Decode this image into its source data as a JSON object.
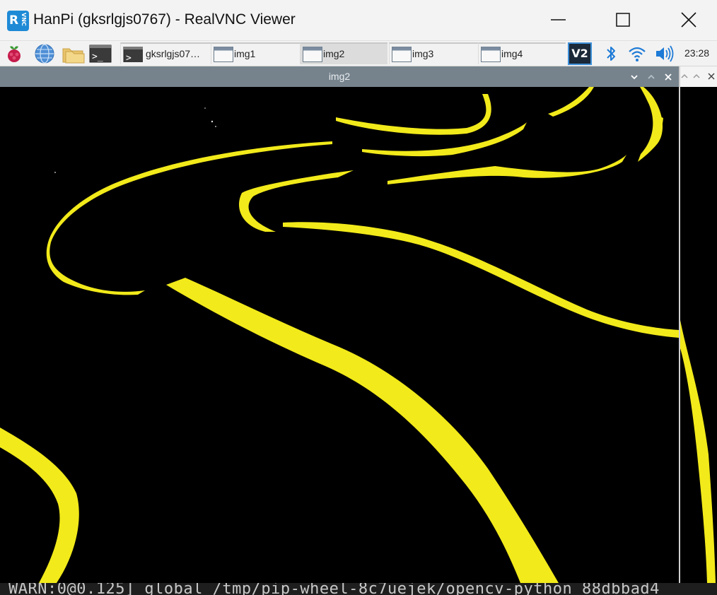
{
  "window": {
    "title": "HanPi (gksrlgjs0767) - RealVNC Viewer",
    "logo_letters": "R",
    "logo_small": "VNC"
  },
  "panel": {
    "launchers": [
      {
        "icon": "raspberry-menu-icon"
      },
      {
        "icon": "web-browser-icon"
      },
      {
        "icon": "file-manager-icon"
      },
      {
        "icon": "terminal-icon"
      }
    ],
    "tasks": [
      {
        "label": "gksrlgjs07…",
        "icon": "terminal-icon",
        "active": false
      },
      {
        "label": "img1",
        "icon": "window-icon",
        "active": false
      },
      {
        "label": "img2",
        "icon": "window-icon",
        "active": true
      },
      {
        "label": "img3",
        "icon": "window-icon",
        "active": false
      },
      {
        "label": "img4",
        "icon": "window-icon",
        "active": false
      }
    ],
    "tray": {
      "vnc_label": "V2",
      "icons": [
        "bluetooth-icon",
        "wifi-icon",
        "volume-icon"
      ],
      "clock": "23:28"
    }
  },
  "image_window": {
    "title": "img2",
    "controls": [
      "minimize",
      "maximize",
      "close"
    ],
    "content": "Binary mask image showing yellow lane/tape lines on black background"
  },
  "terminal": {
    "line": "WARN:0@0.125] global /tmp/pip-wheel-8c7uejek/opencv-python_88dbbad4"
  },
  "colors": {
    "titlebar_bg": "#f3f3f3",
    "panel_bg": "#f2f2f2",
    "image_titlebar": "#76838d",
    "lane_yellow": "#f2ea1a",
    "accent_blue": "#1e8ad6"
  }
}
